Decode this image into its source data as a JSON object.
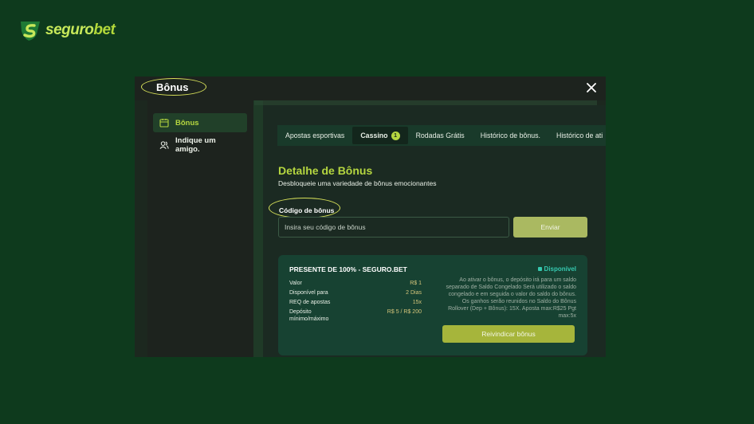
{
  "brand": {
    "logo_text_a": "seguro",
    "logo_text_b": "bet"
  },
  "modal": {
    "title": "Bônus",
    "close_icon": "close-icon"
  },
  "sidebar": {
    "items": [
      {
        "label": "Bônus",
        "icon": "gift-calendar-icon",
        "active": true
      },
      {
        "label": "Indique um amigo.",
        "icon": "users-icon",
        "active": false
      }
    ]
  },
  "tabs": [
    {
      "label": "Apostas esportivas"
    },
    {
      "label": "Cassino",
      "badge": "1",
      "active": true
    },
    {
      "label": "Rodadas Grátis"
    },
    {
      "label": "Histórico de bônus."
    },
    {
      "label": "Histórico de ati"
    }
  ],
  "detail": {
    "title": "Detalhe de Bônus",
    "subtitle": "Desbloqueie uma variedade de bônus emocionantes"
  },
  "code": {
    "label": "Código de bônus",
    "placeholder": "Insira seu código de bônus",
    "value": "",
    "send_label": "Enviar"
  },
  "bonus_card": {
    "title": "PRESENTE DE 100% - SEGURO.BET",
    "status": "Disponível",
    "rows": [
      {
        "key": "Valor",
        "value": "R$ 1"
      },
      {
        "key": "Disponível para",
        "value": "2 Dias"
      },
      {
        "key": "REQ de apostas",
        "value": "15x"
      },
      {
        "key": "Depósito mínimo/máximo",
        "value": "R$ 5 / R$ 200"
      }
    ],
    "description": "Ao ativar o bônus, o depósito irá para um saldo separado de Saldo Congelado Será utilizado o saldo congelado e em seguida o valor do saldo do bônus. Os ganhos serão reunidos no Saldo do Bônus Rollover (Dep + Bônus): 15X. Aposta max:R$25 Pgt max:5x",
    "claim_label": "Reivindicar bônus"
  },
  "colors": {
    "page_bg": "#0e3a1d",
    "accent": "#b5d640",
    "status": "#36c9b0"
  }
}
